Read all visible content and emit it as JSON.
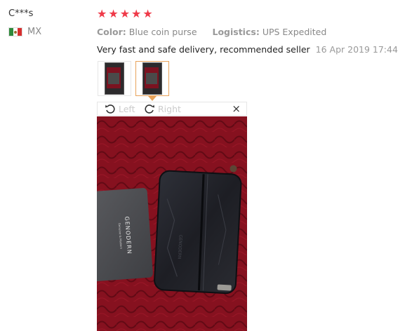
{
  "reviewer": {
    "name": "C***s",
    "country": "MX",
    "flag_icon": "mexico-flag-icon"
  },
  "rating": {
    "stars": 5,
    "max": 5,
    "color": "#ef3a49"
  },
  "order_info": {
    "color_label": "Color:",
    "color_value": "Blue coin purse",
    "logistics_label": "Logistics:",
    "logistics_value": "UPS Expedited"
  },
  "review": {
    "text": "Very fast and safe delivery, recommended seller",
    "date": "16 Apr 2019 17:44"
  },
  "photos": {
    "count": 2,
    "selected_index": 1,
    "selected_border": "#e8a35a"
  },
  "viewer": {
    "rotate_left_label": "Left",
    "rotate_right_label": "Right",
    "close_label": "×"
  },
  "photo_content": {
    "card_text": "GENODERN",
    "card_subtext": "Genuine & Modern"
  }
}
